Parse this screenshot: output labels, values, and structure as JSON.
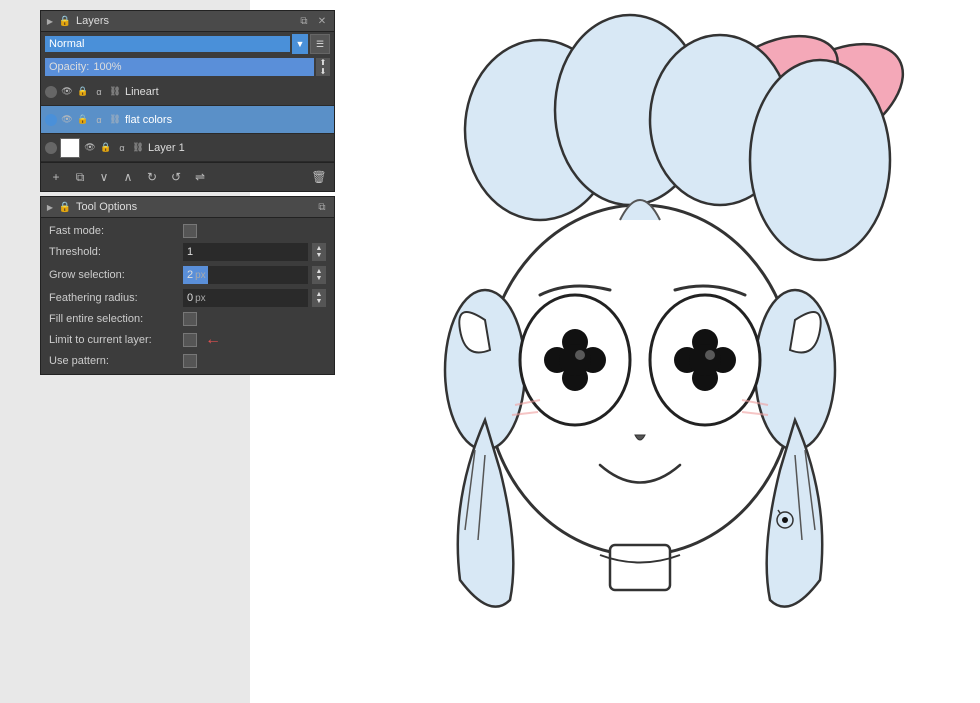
{
  "canvas": {
    "background": "#e8e8e8"
  },
  "layers_panel": {
    "title": "Layers",
    "mode": "Normal",
    "opacity_label": "Opacity:",
    "opacity_value": "100%",
    "layers": [
      {
        "name": "Lineart",
        "visible": true,
        "selected": false,
        "has_thumb": false
      },
      {
        "name": "flat colors",
        "visible": true,
        "selected": true,
        "has_thumb": false
      },
      {
        "name": "Layer 1",
        "visible": true,
        "selected": false,
        "has_thumb": true
      }
    ],
    "toolbar_buttons": [
      "+",
      "⧉",
      "∨",
      "∧",
      "↻",
      "↺",
      "⇌",
      "🗑"
    ]
  },
  "tool_options_panel": {
    "title": "Tool Options",
    "options": [
      {
        "label": "Fast mode:",
        "type": "checkbox",
        "value": false
      },
      {
        "label": "Threshold:",
        "type": "value_plain",
        "value": "1",
        "unit": ""
      },
      {
        "label": "Grow selection:",
        "type": "value_bar",
        "value": "2",
        "unit": "px",
        "bar_pct": 20
      },
      {
        "label": "Feathering radius:",
        "type": "value_plain",
        "value": "0",
        "unit": "px"
      },
      {
        "label": "Fill entire selection:",
        "type": "checkbox",
        "value": false
      },
      {
        "label": "Limit to current layer:",
        "type": "checkbox",
        "value": false,
        "has_arrow": true
      },
      {
        "label": "Use pattern:",
        "type": "checkbox",
        "value": false
      }
    ]
  }
}
